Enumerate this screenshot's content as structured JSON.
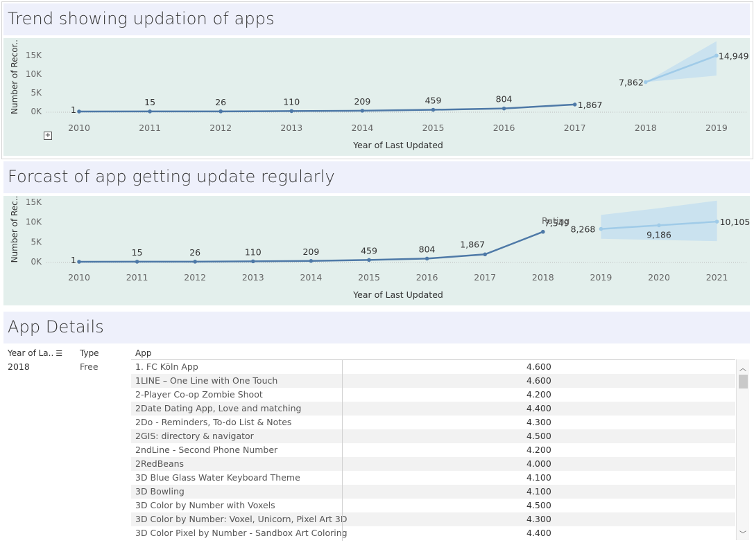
{
  "panel1": {
    "title": "Trend showing updation of apps",
    "ylabel": "Number of Recor..",
    "xlabel": "Year of Last Updated",
    "yticks": [
      "15K",
      "10K",
      "5K",
      "0K"
    ],
    "years": [
      "2010",
      "2011",
      "2012",
      "2013",
      "2014",
      "2015",
      "2016",
      "2017",
      "2018",
      "2019"
    ],
    "actual_labels": [
      "1",
      "15",
      "26",
      "110",
      "209",
      "459",
      "804",
      "1,867"
    ],
    "forecast_labels": [
      "7,862",
      "14,949"
    ]
  },
  "panel2": {
    "title": "Forcast of app getting update regularly",
    "ylabel": "Number of Rec..",
    "xlabel": "Year of Last Updated",
    "yticks": [
      "15K",
      "10K",
      "5K",
      "0K"
    ],
    "years": [
      "2010",
      "2011",
      "2012",
      "2013",
      "2014",
      "2015",
      "2016",
      "2017",
      "2018",
      "2019",
      "2020",
      "2021"
    ],
    "actual_labels": [
      "1",
      "15",
      "26",
      "110",
      "209",
      "459",
      "804",
      "1,867",
      "7,549"
    ],
    "forecast_labels": [
      "8,268",
      "9,186",
      "10,105"
    ],
    "overlap_text": "Rating"
  },
  "chart_data": [
    {
      "type": "line",
      "title": "Trend showing updation of apps",
      "xlabel": "Year of Last Updated",
      "ylabel": "Number of Recor..",
      "ylim": [
        0,
        16000
      ],
      "series": [
        {
          "x": [
            2010,
            2011,
            2012,
            2013,
            2014,
            2015,
            2016,
            2017
          ],
          "values": [
            1,
            15,
            26,
            110,
            209,
            459,
            804,
            1867
          ]
        },
        {
          "x": [
            2018,
            2019
          ],
          "values": [
            7862,
            14949
          ],
          "band_low": [
            7862,
            9600
          ],
          "band_high": [
            7862,
            18800
          ]
        }
      ]
    },
    {
      "type": "line",
      "title": "Forcast of app getting update regularly",
      "xlabel": "Year of Last Updated",
      "ylabel": "Number of Rec..",
      "ylim": [
        0,
        16000
      ],
      "series": [
        {
          "x": [
            2010,
            2011,
            2012,
            2013,
            2014,
            2015,
            2016,
            2017,
            2018
          ],
          "values": [
            1,
            15,
            26,
            110,
            209,
            459,
            804,
            1867,
            7549
          ]
        },
        {
          "x": [
            2019,
            2020,
            2021
          ],
          "values": [
            8268,
            9186,
            10105
          ],
          "band_low": [
            5800,
            5500,
            5200
          ],
          "band_high": [
            11800,
            13500,
            15400
          ]
        }
      ]
    }
  ],
  "table": {
    "title": "App Details",
    "headers": {
      "year": "Year of La..",
      "type": "Type",
      "app": "App"
    },
    "year_value": "2018",
    "type_value": "Free",
    "rows": [
      {
        "app": "1. FC Köln App",
        "rating": "4.600"
      },
      {
        "app": "1LINE – One Line with One Touch",
        "rating": "4.600"
      },
      {
        "app": "2-Player Co-op Zombie Shoot",
        "rating": "4.200"
      },
      {
        "app": "2Date Dating App, Love and matching",
        "rating": "4.400"
      },
      {
        "app": "2Do - Reminders, To-do List & Notes",
        "rating": "4.300"
      },
      {
        "app": "2GIS: directory & navigator",
        "rating": "4.500"
      },
      {
        "app": "2ndLine - Second Phone Number",
        "rating": "4.200"
      },
      {
        "app": "2RedBeans",
        "rating": "4.000"
      },
      {
        "app": "3D Blue Glass Water Keyboard Theme",
        "rating": "4.100"
      },
      {
        "app": "3D Bowling",
        "rating": "4.100"
      },
      {
        "app": "3D Color by Number with Voxels",
        "rating": "4.500"
      },
      {
        "app": "3D Color by Number: Voxel, Unicorn, Pixel Art 3D",
        "rating": "4.300"
      },
      {
        "app": "3D Color Pixel by Number - Sandbox Art Coloring",
        "rating": "4.400"
      }
    ]
  },
  "colors": {
    "actual_line": "#4e79a7",
    "forecast_line": "#a0cbe8",
    "band": "#c5dff0",
    "chart_bg": "#e3efec",
    "title_bg": "#eef0fb"
  },
  "icons": {
    "expand": "plus-square-icon",
    "sort": "sort-descending-icon",
    "scroll_up": "chevron-up-icon",
    "scroll_down": "chevron-down-icon"
  }
}
